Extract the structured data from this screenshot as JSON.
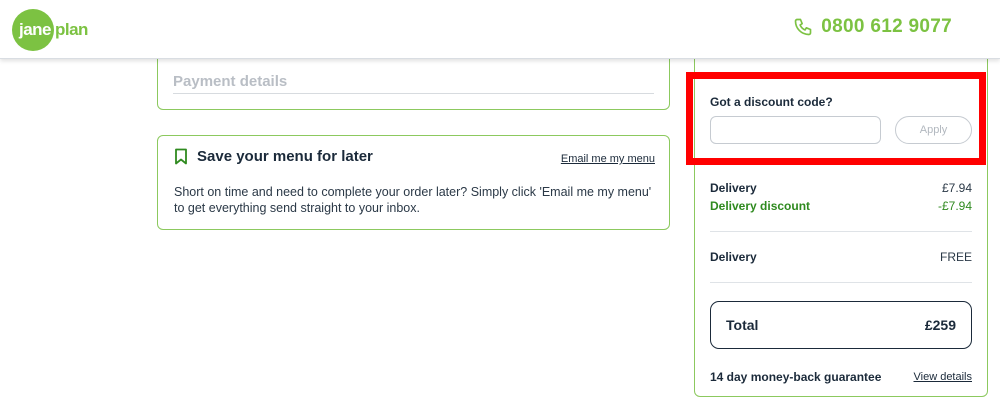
{
  "header": {
    "logo_jane": "jane",
    "logo_plan": "plan",
    "phone_number": "0800 612 9077"
  },
  "payment": {
    "label": "Payment details"
  },
  "save_menu": {
    "title": "Save your menu for later",
    "email_link": "Email me my menu",
    "description": "Short on time and need to complete your order later? Simply click 'Email me my menu' to get everything send straight to your inbox."
  },
  "summary": {
    "discount_label": "Got a discount code?",
    "discount_value": "",
    "discount_placeholder": "",
    "apply_label": "Apply",
    "delivery_label": "Delivery",
    "delivery_value": "£7.94",
    "delivery_discount_label": "Delivery discount",
    "delivery_discount_value": "-£7.94",
    "delivery2_label": "Delivery",
    "delivery2_value": "FREE",
    "total_label": "Total",
    "total_value": "£259",
    "guarantee": "14 day money-back guarantee",
    "view_details": "View details"
  },
  "colors": {
    "brand_green": "#7cc242",
    "discount_green": "#2f8a1f",
    "highlight_red": "#ff0000",
    "text_dark": "#1b2a3a"
  },
  "icons": {
    "phone": "phone-icon",
    "bookmark": "bookmark-icon"
  }
}
